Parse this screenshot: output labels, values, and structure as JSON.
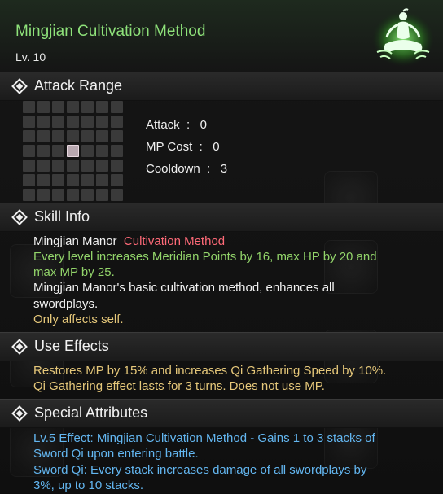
{
  "header": {
    "title": "Mingjian Cultivation Method",
    "level": "Lv.  10"
  },
  "sections": {
    "attack_range": "Attack Range",
    "skill_info": "Skill Info",
    "use_effects": "Use Effects",
    "special_attributes": "Special Attributes"
  },
  "range_grid": {
    "columns": 7,
    "rows": 7,
    "active_cell": {
      "row": 3,
      "col": 3
    }
  },
  "stats": {
    "attack": "Attack  :   0",
    "mp_cost": "MP Cost  :   0",
    "cooldown": "Cooldown  :   3"
  },
  "skill_info": {
    "school": "Mingjian Manor",
    "type": "Cultivation Method",
    "line1": "Every level increases Meridian Points by 16, max HP by 20 and",
    "line2": "max MP by 25.",
    "line3": "Mingjian Manor's basic cultivation method, enhances all",
    "line4": "swordplays.",
    "line5": "Only affects self."
  },
  "use_effects": {
    "line1": "Restores MP by 15% and increases Qi Gathering Speed by 10%.",
    "line2": "Qi Gathering effect lasts for 3 turns. Does not use MP."
  },
  "special_attributes": {
    "line1": "Lv.5 Effect: Mingjian Cultivation Method - Gains 1 to 3 stacks of",
    "line2": "Sword Qi upon entering battle.",
    "line3": "Sword Qi: Every stack increases damage of all swordplays by",
    "line4": "3%, up to 10 stacks."
  },
  "colors": {
    "title_green": "#8ee27a",
    "type_pink": "#ff6a78",
    "effect_green": "#92d46a",
    "note_tan": "#e6c87a",
    "attr_blue": "#63b6f0"
  },
  "icons": {
    "skill": "meditating-figure-icon",
    "section_marker": "diamond-icon"
  }
}
